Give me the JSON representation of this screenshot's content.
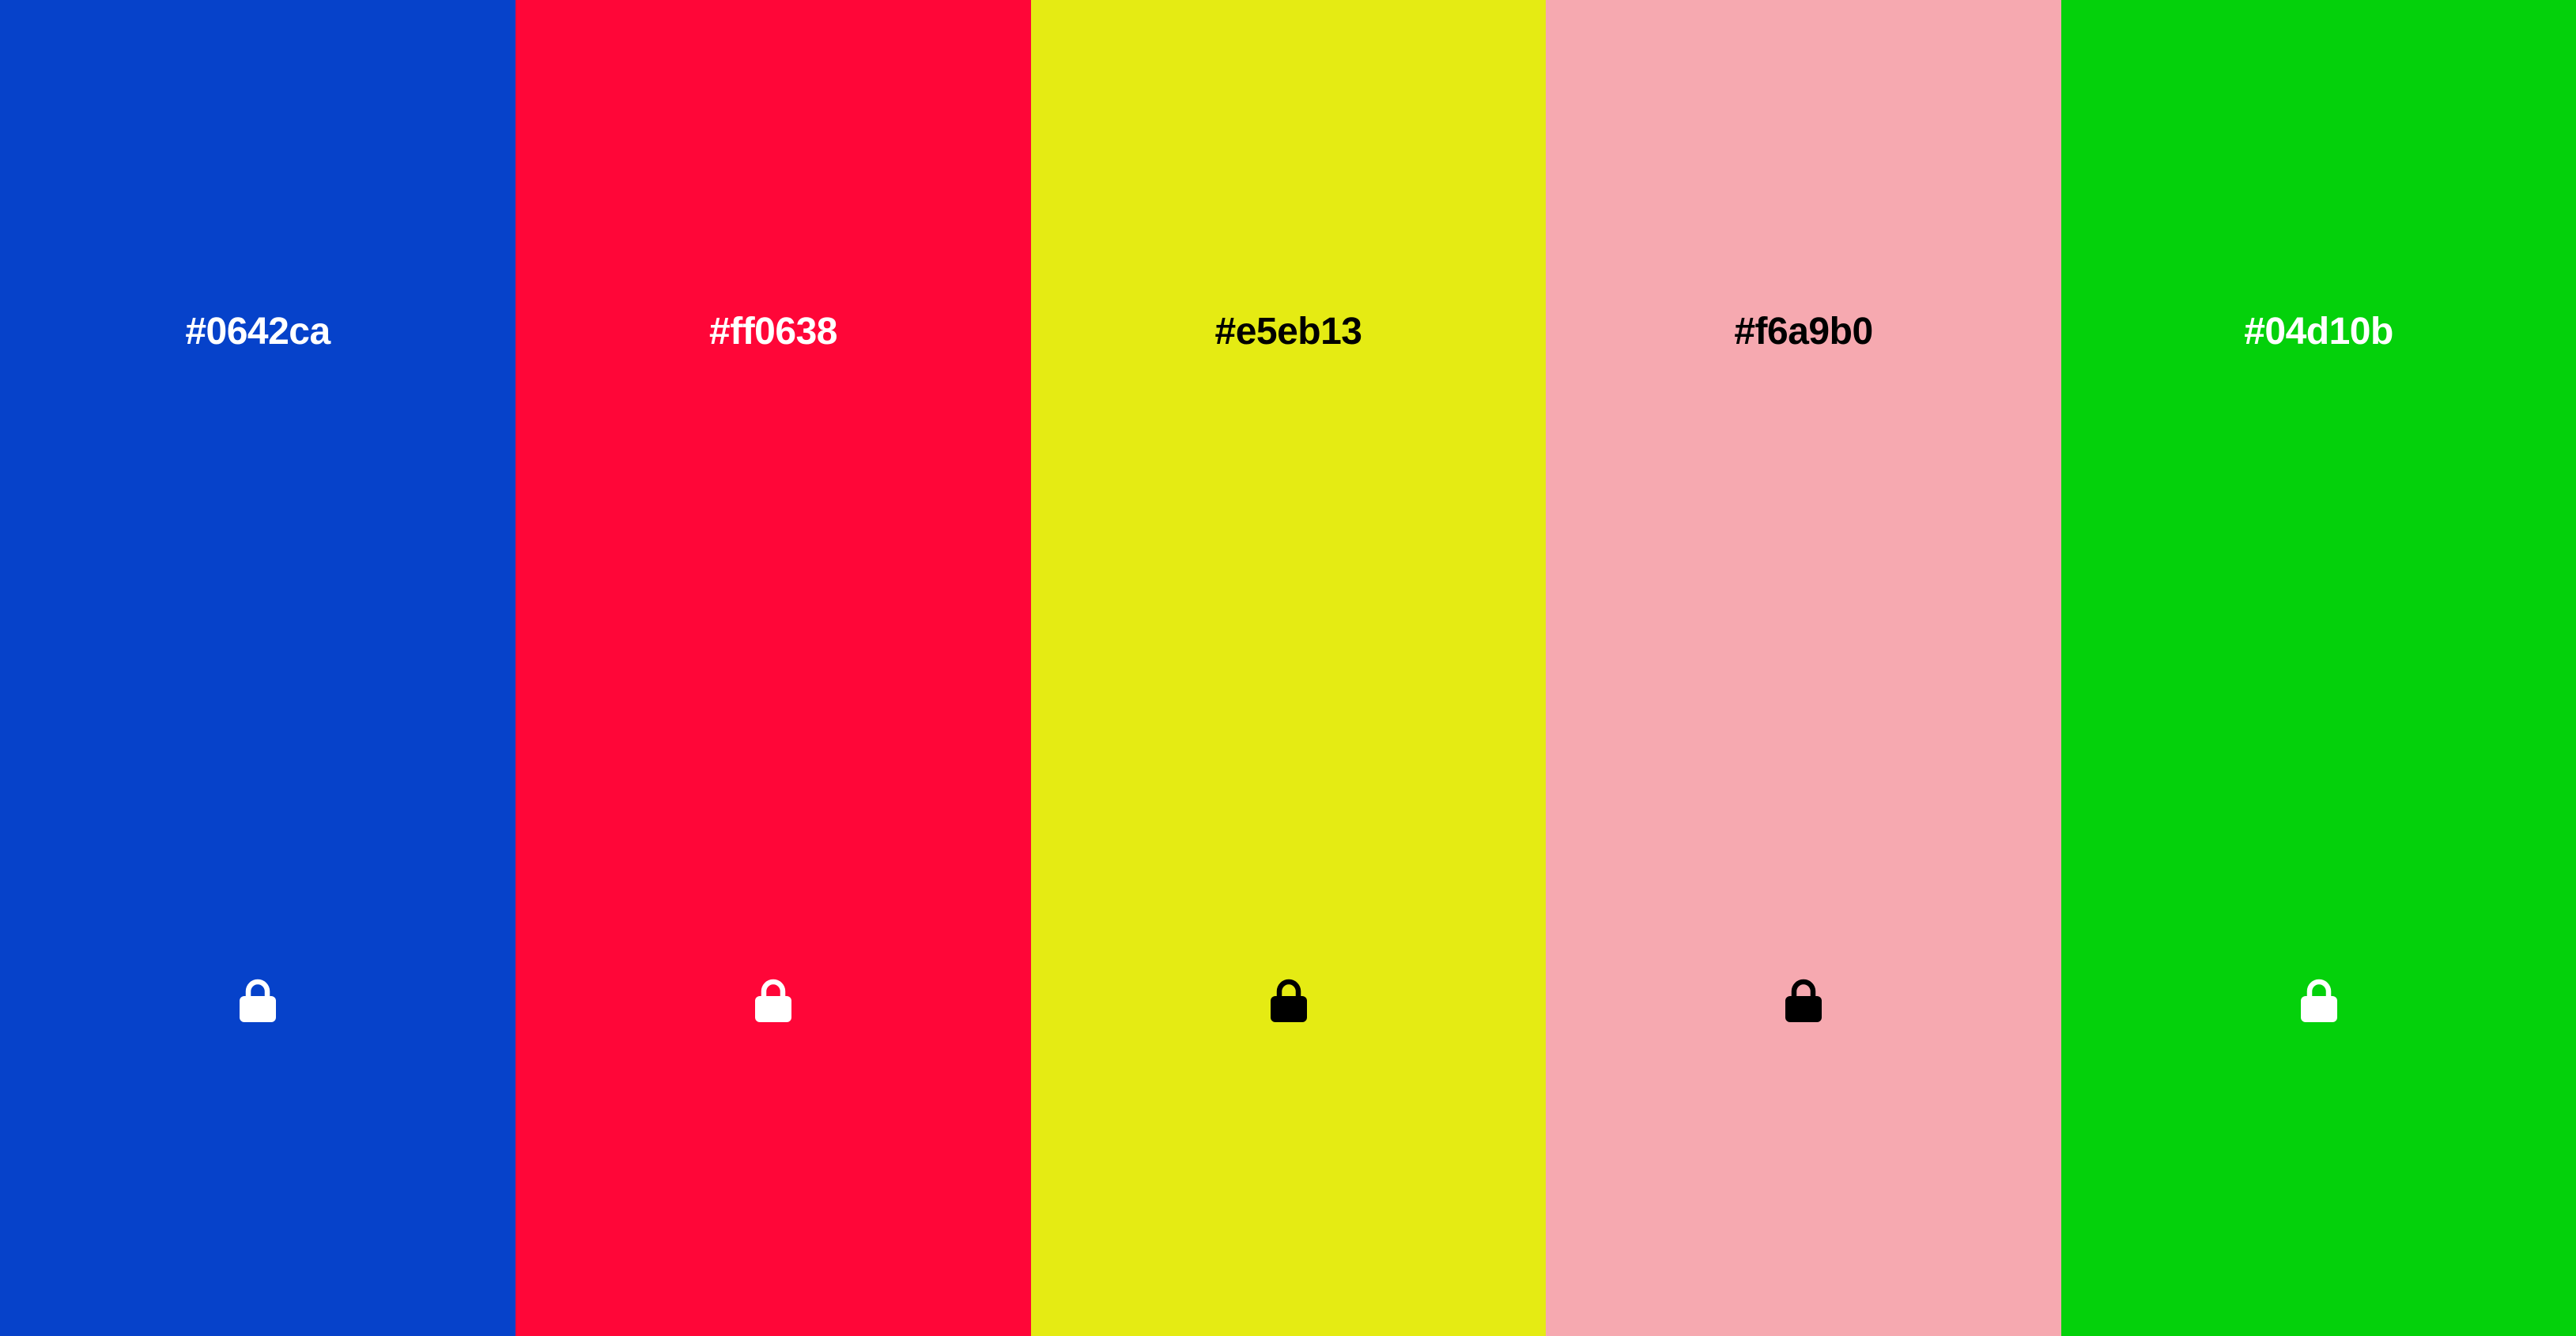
{
  "swatches": [
    {
      "hex": "#0642ca",
      "background": "#0642ca",
      "text_color": "#ffffff",
      "icon": "lock-icon",
      "locked": true
    },
    {
      "hex": "#ff0638",
      "background": "#ff0638",
      "text_color": "#ffffff",
      "icon": "lock-icon",
      "locked": true
    },
    {
      "hex": "#e5eb13",
      "background": "#e5eb13",
      "text_color": "#000000",
      "icon": "lock-icon",
      "locked": true
    },
    {
      "hex": "#f6a9b0",
      "background": "#f6a9b0",
      "text_color": "#000000",
      "icon": "lock-icon",
      "locked": true
    },
    {
      "hex": "#04d10b",
      "background": "#04d10b",
      "text_color": "#ffffff",
      "icon": "lock-icon",
      "locked": true
    }
  ]
}
